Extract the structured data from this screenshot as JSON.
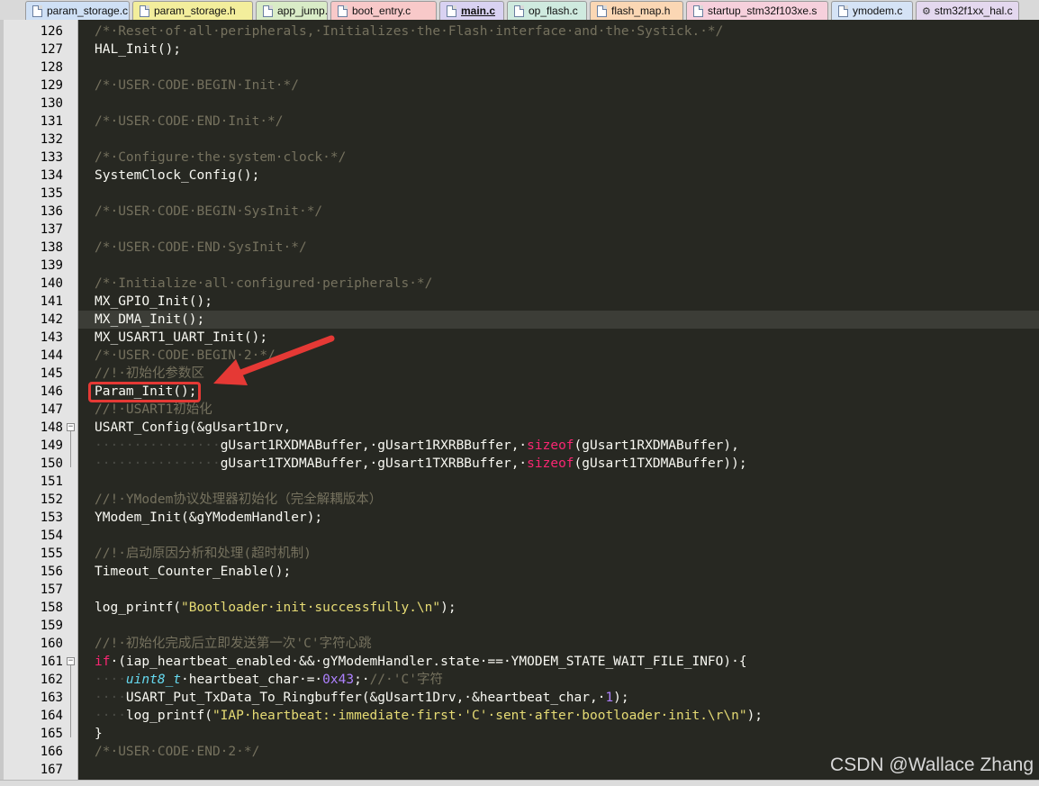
{
  "tabs": [
    {
      "label": "param_storage.c",
      "color": "#cfe0f5",
      "active": false
    },
    {
      "label": "param_storage.h",
      "color": "#f3ee9c",
      "active": false
    },
    {
      "label": "app_jump.c",
      "color": "#d9ecc7",
      "active": false
    },
    {
      "label": "boot_entry.c",
      "color": "#f8c9c9",
      "active": false
    },
    {
      "label": "main.c",
      "color": "#d9d2f2",
      "active": true
    },
    {
      "label": "op_flash.c",
      "color": "#cfeadf",
      "active": false
    },
    {
      "label": "flash_map.h",
      "color": "#fbd7b4",
      "active": false
    },
    {
      "label": "startup_stm32f103xe.s",
      "color": "#f6d0dc",
      "active": false
    },
    {
      "label": "ymodem.c",
      "color": "#d5e3f6",
      "active": false
    },
    {
      "label": "stm32f1xx_hal.c",
      "color": "#e4d8ef",
      "active": false
    }
  ],
  "accent_colors": {
    "highlight_box": "#e53935",
    "current_line": "#3c3d37",
    "editor_bg": "#272822"
  },
  "code_lines": [
    {
      "num": "126",
      "html": "<span class=\"c\">/*·Reset·of·all·peripherals,·Initializes·the·Flash·interface·and·the·Systick.·*/</span>"
    },
    {
      "num": "127",
      "html": "HAL_Init();"
    },
    {
      "num": "128",
      "html": ""
    },
    {
      "num": "129",
      "html": "<span class=\"c\">/*·USER·CODE·BEGIN·Init·*/</span>"
    },
    {
      "num": "130",
      "html": ""
    },
    {
      "num": "131",
      "html": "<span class=\"c\">/*·USER·CODE·END·Init·*/</span>"
    },
    {
      "num": "132",
      "html": ""
    },
    {
      "num": "133",
      "html": "<span class=\"c\">/*·Configure·the·system·clock·*/</span>"
    },
    {
      "num": "134",
      "html": "SystemClock_Config();"
    },
    {
      "num": "135",
      "html": ""
    },
    {
      "num": "136",
      "html": "<span class=\"c\">/*·USER·CODE·BEGIN·SysInit·*/</span>"
    },
    {
      "num": "137",
      "html": ""
    },
    {
      "num": "138",
      "html": "<span class=\"c\">/*·USER·CODE·END·SysInit·*/</span>"
    },
    {
      "num": "139",
      "html": ""
    },
    {
      "num": "140",
      "html": "<span class=\"c\">/*·Initialize·all·configured·peripherals·*/</span>"
    },
    {
      "num": "141",
      "html": "MX_GPIO_Init();"
    },
    {
      "num": "142",
      "html": "MX_DMA_Init();",
      "highlight": true
    },
    {
      "num": "143",
      "html": "MX_USART1_UART_Init();"
    },
    {
      "num": "144",
      "html": "<span class=\"c\">/*·USER·CODE·BEGIN·2·*/</span>"
    },
    {
      "num": "145",
      "html": "<span class=\"c\">//!·初始化参数区</span>"
    },
    {
      "num": "146",
      "html": "Param_Init();"
    },
    {
      "num": "147",
      "html": "<span class=\"c\">//!·USART1初始化</span>"
    },
    {
      "num": "148",
      "html": "USART_Config(&amp;gUsart1Drv,",
      "fold": "minus"
    },
    {
      "num": "149",
      "html": "<span class=\"dot\">················</span>gUsart1RXDMABuffer,·gUsart1RXRBBuffer,·<span class=\"k\">sizeof</span>(gUsart1RXDMABuffer),"
    },
    {
      "num": "150",
      "html": "<span class=\"dot\">················</span>gUsart1TXDMABuffer,·gUsart1TXRBBuffer,·<span class=\"k\">sizeof</span>(gUsart1TXDMABuffer));"
    },
    {
      "num": "151",
      "html": ""
    },
    {
      "num": "152",
      "html": "<span class=\"c\">//!·YModem协议处理器初始化（完全解耦版本）</span>"
    },
    {
      "num": "153",
      "html": "YModem_Init(&amp;gYModemHandler);"
    },
    {
      "num": "154",
      "html": ""
    },
    {
      "num": "155",
      "html": "<span class=\"c\">//!·启动原因分析和处理(超时机制)</span>"
    },
    {
      "num": "156",
      "html": "Timeout_Counter_Enable();"
    },
    {
      "num": "157",
      "html": ""
    },
    {
      "num": "158",
      "html": "log_printf(<span class=\"s\">\"Bootloader·init·successfully.\\n\"</span>);"
    },
    {
      "num": "159",
      "html": ""
    },
    {
      "num": "160",
      "html": "<span class=\"c\">//!·初始化完成后立即发送第一次'C'字符心跳</span>"
    },
    {
      "num": "161",
      "html": "<span class=\"k\">if</span>·(iap_heartbeat_enabled·&amp;&amp;·gYModemHandler.state·==·YMODEM_STATE_WAIT_FILE_INFO)·{",
      "fold": "minus"
    },
    {
      "num": "162",
      "html": "<span class=\"dot\">····</span><span class=\"t\">uint8_t</span>·heartbeat_char·=·<span class=\"n\">0x43</span>;·<span class=\"c\">//·'C'字符</span>"
    },
    {
      "num": "163",
      "html": "<span class=\"dot\">····</span>USART_Put_TxData_To_Ringbuffer(&amp;gUsart1Drv,·&amp;heartbeat_char,·<span class=\"n\">1</span>);"
    },
    {
      "num": "164",
      "html": "<span class=\"dot\">····</span>log_printf(<span class=\"s\">\"IAP·heartbeat:·immediate·first·'C'·sent·after·bootloader·init.\\r\\n\"</span>);"
    },
    {
      "num": "165",
      "html": "}"
    },
    {
      "num": "166",
      "html": "<span class=\"c\">/*·USER·CODE·END·2·*/</span>"
    },
    {
      "num": "167",
      "html": ""
    }
  ],
  "watermark": "CSDN @Wallace Zhang"
}
